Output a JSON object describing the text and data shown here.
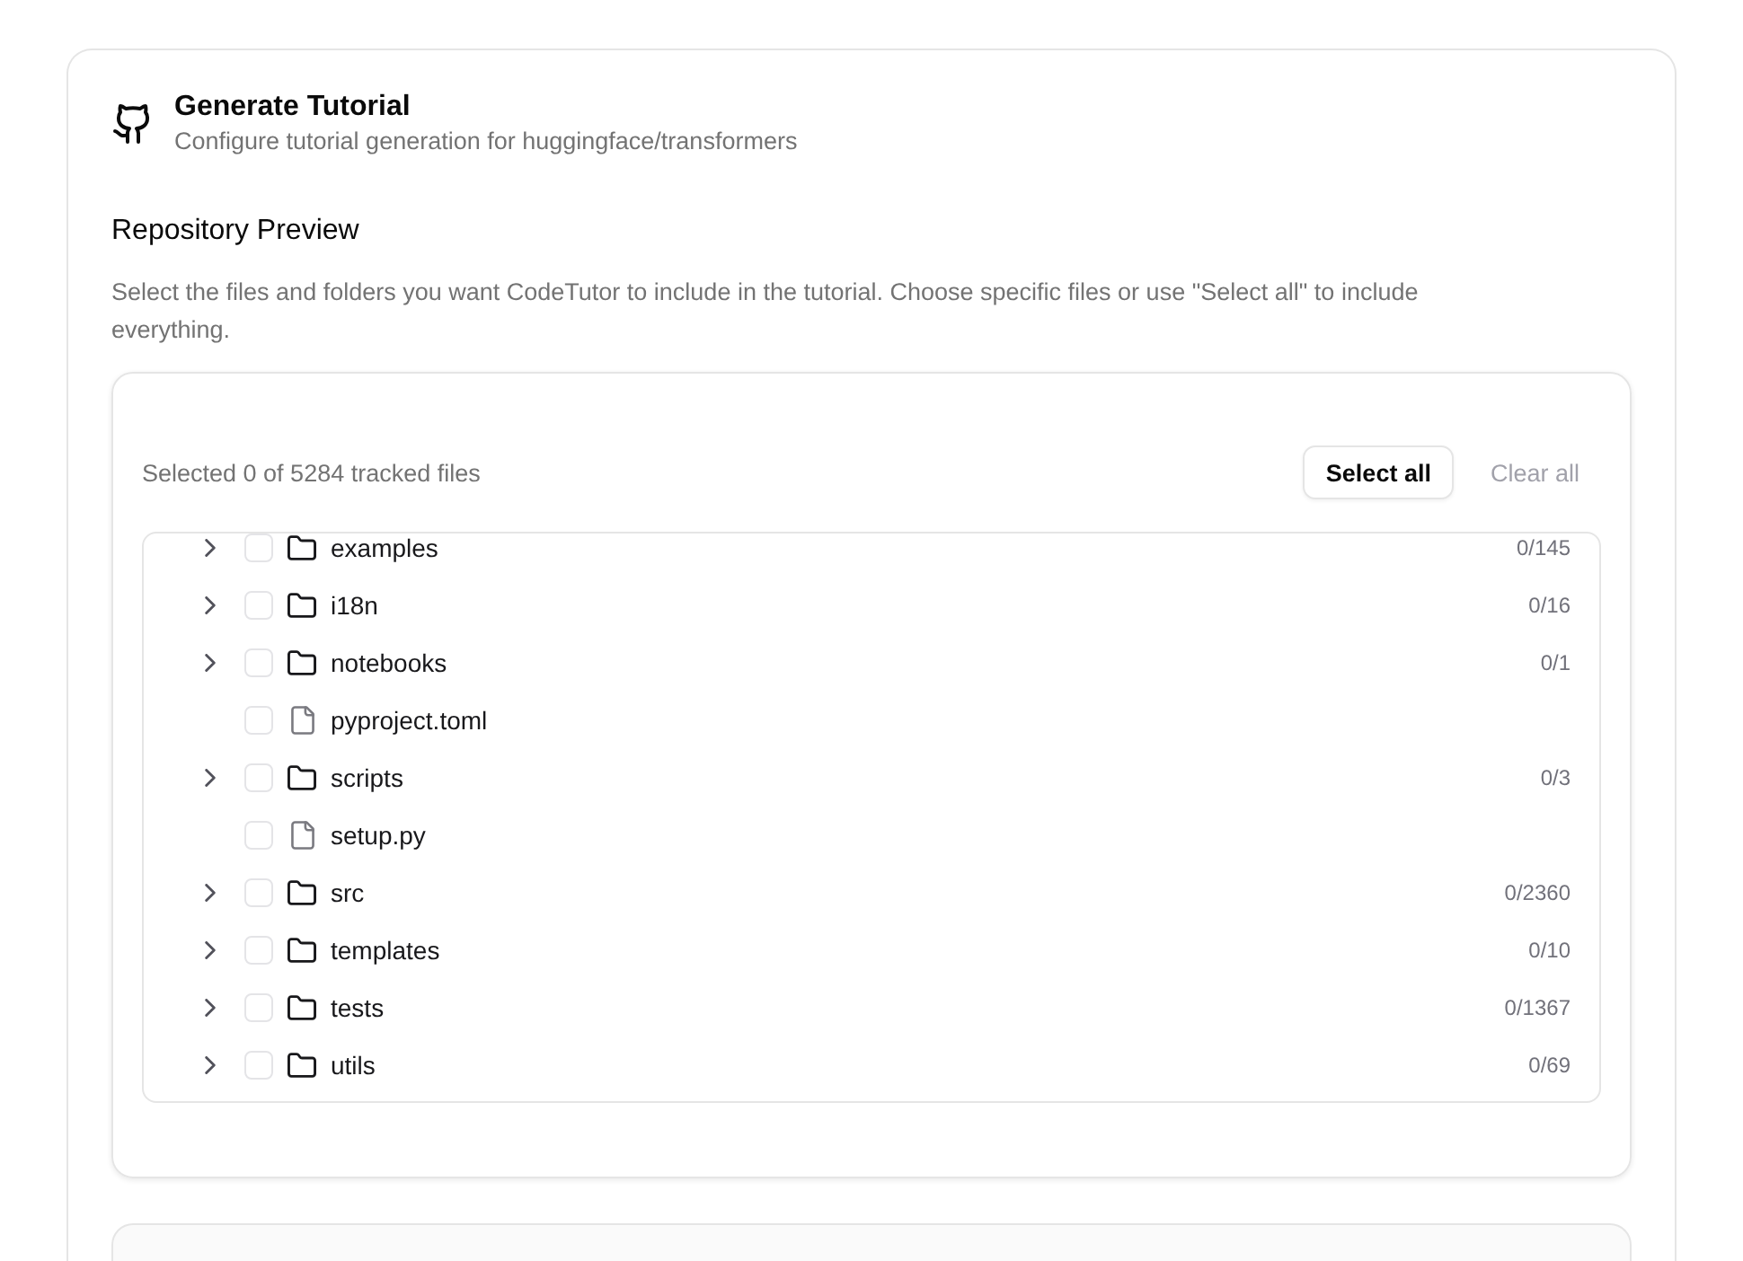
{
  "header": {
    "title": "Generate Tutorial",
    "subtitle": "Configure tutorial generation for huggingface/transformers"
  },
  "repository_preview": {
    "heading": "Repository Preview",
    "description": "Select the files and folders you want CodeTutor to include in the tutorial. Choose specific files or use \"Select all\" to include everything.",
    "selection_summary": "Selected 0 of 5284 tracked files",
    "actions": [
      {
        "label": "Select all",
        "kind": "outlined"
      },
      {
        "label": "Clear all",
        "kind": "text"
      }
    ],
    "tree": [
      {
        "name": "examples",
        "kind": "folder",
        "expanded": false,
        "checked": false,
        "count": "0/145"
      },
      {
        "name": "i18n",
        "kind": "folder",
        "expanded": false,
        "checked": false,
        "count": "0/16"
      },
      {
        "name": "notebooks",
        "kind": "folder",
        "expanded": false,
        "checked": false,
        "count": "0/1"
      },
      {
        "name": "pyproject.toml",
        "kind": "file",
        "checked": false
      },
      {
        "name": "scripts",
        "kind": "folder",
        "expanded": false,
        "checked": false,
        "count": "0/3"
      },
      {
        "name": "setup.py",
        "kind": "file",
        "checked": false
      },
      {
        "name": "src",
        "kind": "folder",
        "expanded": false,
        "checked": false,
        "count": "0/2360"
      },
      {
        "name": "templates",
        "kind": "folder",
        "expanded": false,
        "checked": false,
        "count": "0/10"
      },
      {
        "name": "tests",
        "kind": "folder",
        "expanded": false,
        "checked": false,
        "count": "0/1367"
      },
      {
        "name": "utils",
        "kind": "folder",
        "expanded": false,
        "checked": false,
        "count": "0/69"
      }
    ]
  }
}
